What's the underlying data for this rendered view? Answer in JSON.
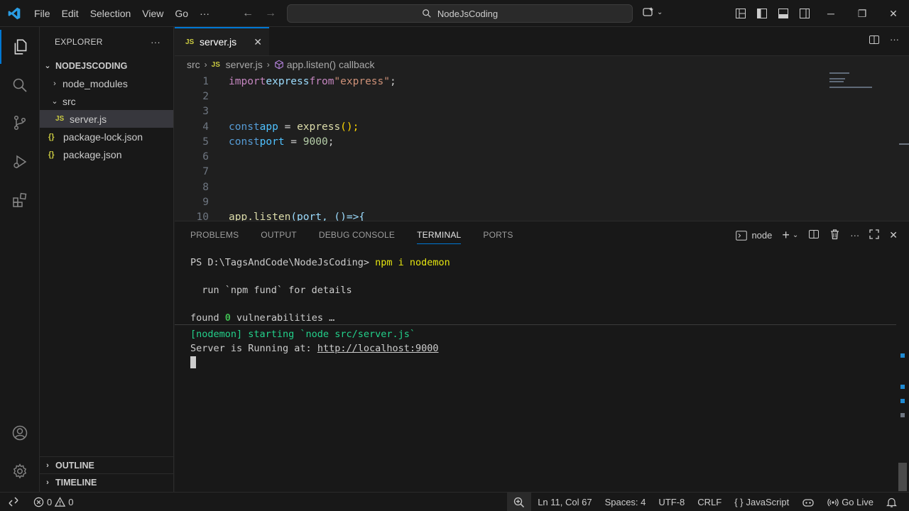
{
  "menu": [
    "File",
    "Edit",
    "Selection",
    "View",
    "Go",
    "···"
  ],
  "command_center": "NodeJsCoding",
  "sidebar": {
    "title": "EXPLORER",
    "more": "···",
    "root": "NODEJSCODING",
    "items": [
      {
        "label": "node_modules"
      },
      {
        "label": "src"
      },
      {
        "label": "server.js"
      },
      {
        "label": "package-lock.json"
      },
      {
        "label": "package.json"
      }
    ],
    "outline": "OUTLINE",
    "timeline": "TIMELINE"
  },
  "editor": {
    "tab_label": "server.js",
    "breadcrumb": {
      "folder": "src",
      "file": "server.js",
      "symbol": "app.listen() callback"
    },
    "line_numbers": [
      "1",
      "2",
      "3",
      "4",
      "5",
      "6",
      "7",
      "8",
      "9",
      "10"
    ],
    "code": {
      "l1_kw": "import",
      "l1_id": "express",
      "l1_from": "from",
      "l1_str": "\"express\"",
      "l1_end": ";",
      "l4_kw": "const",
      "l4_id": "app",
      "l4_eq": " = ",
      "l4_fn": "express",
      "l4_call": "();",
      "l5_kw": "const",
      "l5_id": "port",
      "l5_eq": " = ",
      "l5_num": "9000",
      "l5_end": ";",
      "l10_fn": "app.listen",
      "l10_args": "(port, ()=>{"
    }
  },
  "panel": {
    "tabs": [
      "PROBLEMS",
      "OUTPUT",
      "DEBUG CONSOLE",
      "TERMINAL",
      "PORTS"
    ],
    "terminal_name": "node",
    "lines": {
      "prompt": "PS D:\\TagsAndCode\\NodeJsCoding> ",
      "command": "npm i nodemon",
      "fund": "  run `npm fund` for details",
      "found_pre": "found ",
      "found_num": "0",
      "found_post": " vulnerabilities …",
      "nodemon": "[nodemon] starting `node src/server.js`",
      "running": "Server is Running at: ",
      "url": "http://localhost:9000"
    }
  },
  "statusbar": {
    "errors": "0",
    "warnings": "0",
    "position": "Ln 11, Col 67",
    "spaces": "Spaces: 4",
    "encoding": "UTF-8",
    "eol": "CRLF",
    "language_braces": "{ }",
    "language": "JavaScript",
    "golive": "Go Live"
  },
  "colors": {
    "accent": "#0078d4",
    "js_badge": "#cbcb41",
    "terminal_green": "#23d18b"
  }
}
